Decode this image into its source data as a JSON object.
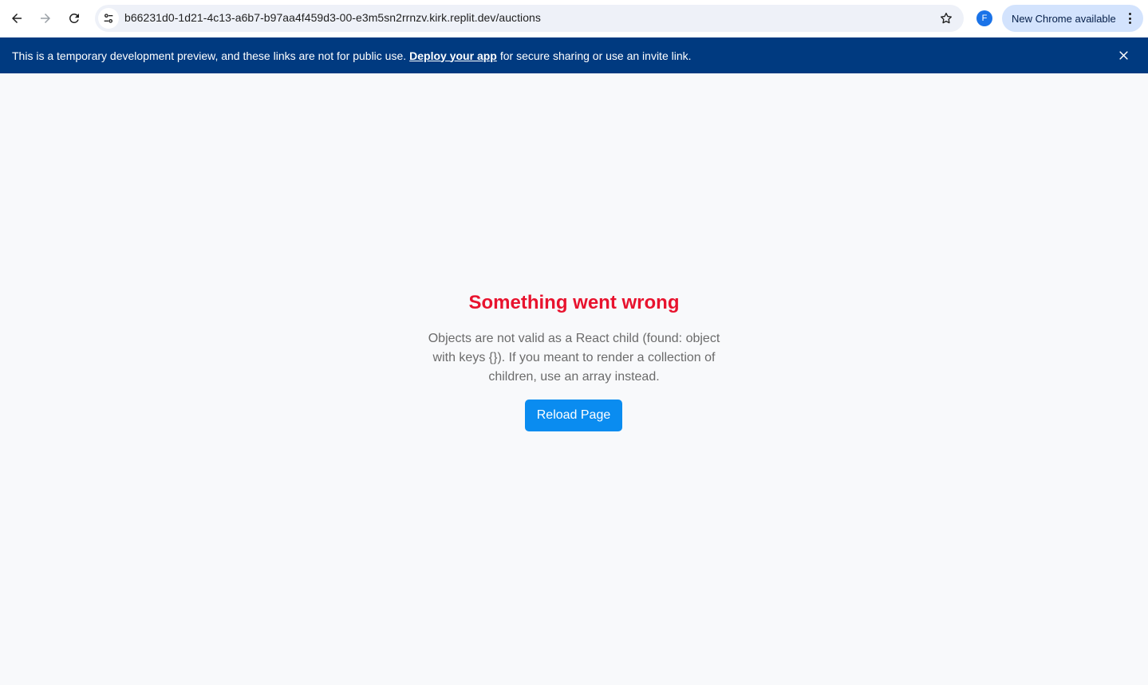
{
  "browser": {
    "url": "b66231d0-1d21-4c13-a6b7-b97aa4f459d3-00-e3m5sn2rrnzv.kirk.replit.dev/auctions",
    "profile_initial": "F",
    "update_label": "New Chrome available",
    "icons": {
      "back": "back-arrow-icon",
      "forward": "forward-arrow-icon",
      "reload": "reload-icon",
      "site_info": "tune-icon",
      "bookmark": "star-icon",
      "menu": "kebab-menu-icon"
    }
  },
  "banner": {
    "text_before": "This is a temporary development preview, and these links are not for public use.",
    "link_label": "Deploy your app",
    "text_after": "for secure sharing or use an invite link.",
    "close_icon": "close-icon",
    "background_color": "#003a80"
  },
  "error": {
    "title": "Something went wrong",
    "message": "Objects are not valid as a React child (found: object with keys {}). If you meant to render a collection of children, use an array instead.",
    "reload_label": "Reload Page",
    "title_color": "#e8132e",
    "button_color": "#0a8cf0"
  }
}
